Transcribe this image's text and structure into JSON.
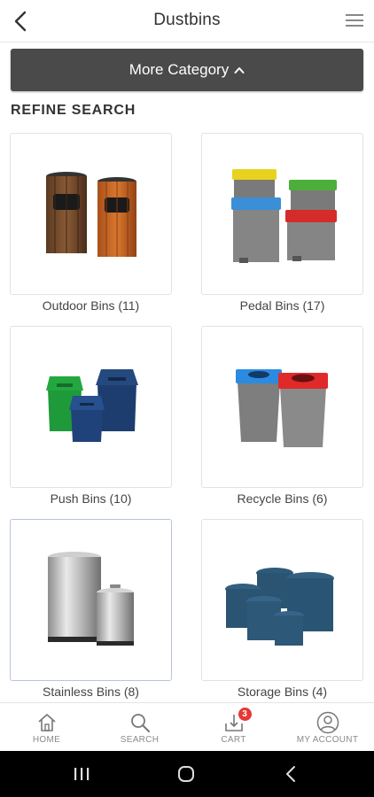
{
  "header": {
    "title": "Dustbins",
    "back_icon": "chevron-left-icon",
    "menu_icon": "hamburger-menu-icon"
  },
  "more_category": {
    "label": "More Category",
    "caret_icon": "chevron-up-icon"
  },
  "refine_search": {
    "label": "REFINE SEARCH"
  },
  "categories": [
    {
      "label": "Outdoor Bins (11)"
    },
    {
      "label": "Pedal Bins (17)"
    },
    {
      "label": "Push Bins (10)"
    },
    {
      "label": "Recycle Bins (6)"
    },
    {
      "label": "Stainless Bins (8)"
    },
    {
      "label": "Storage Bins (4)"
    }
  ],
  "bottom_nav": [
    {
      "label": "HOME",
      "icon": "home-icon"
    },
    {
      "label": "SEARCH",
      "icon": "search-icon"
    },
    {
      "label": "CART",
      "icon": "cart-download-icon",
      "badge": "3"
    },
    {
      "label": "MY ACCOUNT",
      "icon": "account-icon"
    }
  ],
  "colors": {
    "accent_dark": "#4a4a4a",
    "badge": "#e53935"
  }
}
